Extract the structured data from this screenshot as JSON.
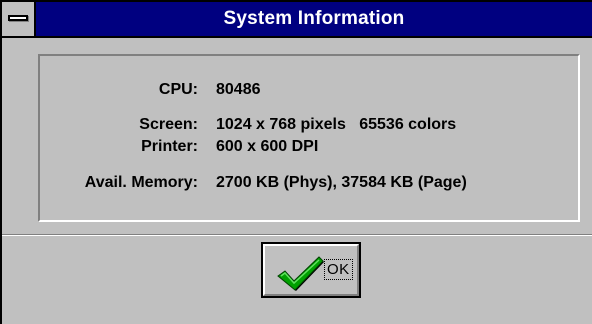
{
  "window": {
    "title": "System Information"
  },
  "info": [
    {
      "label": "CPU:",
      "value": "80486"
    },
    {
      "label": "Screen:",
      "value": "1024 x 768 pixels   65536 colors"
    },
    {
      "label": "Printer:",
      "value": "600 x 600 DPI"
    },
    {
      "label": "Avail. Memory:",
      "value": "2700 KB (Phys), 37584 KB (Page)"
    }
  ],
  "buttons": {
    "ok_label": "OK",
    "ok_icon": "checkmark-icon"
  },
  "colors": {
    "titlebar": "#000080",
    "face": "#c0c0c0",
    "check_green": "#00a000"
  }
}
